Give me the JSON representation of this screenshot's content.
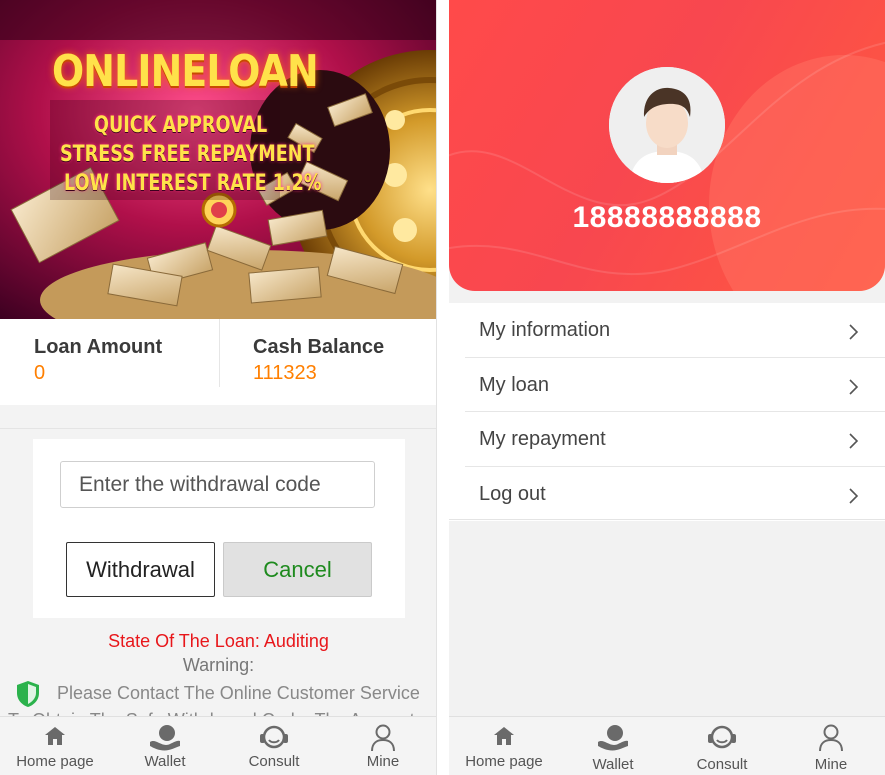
{
  "left": {
    "banner": {
      "title": "ONLINELOAN",
      "lines": [
        "QUICK APPROVAL",
        "STRESS FREE REPAYMENT",
        "LOW INTEREST RATE 1.2%"
      ]
    },
    "stats": {
      "loan_amount_label": "Loan Amount",
      "loan_amount_value": "0",
      "cash_balance_label": "Cash Balance",
      "cash_balance_value": "111323"
    },
    "withdraw": {
      "code_placeholder": "Enter the withdrawal code",
      "withdraw_label": "Withdrawal",
      "cancel_label": "Cancel"
    },
    "status": {
      "state_text": "State Of The Loan:   Auditing",
      "warning_text": "Warning:",
      "notice_text": "Please Contact The Online Customer Service To Obtain The Safe Withdrawal Code. The Account Funds"
    }
  },
  "right": {
    "phone": "18888888888",
    "menu": [
      {
        "label": "My information"
      },
      {
        "label": "My loan"
      },
      {
        "label": "My repayment"
      },
      {
        "label": "Log out"
      }
    ]
  },
  "nav": {
    "left_items": [
      {
        "label": "Home page",
        "icon": "home-icon"
      },
      {
        "label": "Wallet",
        "icon": "wallet-icon"
      },
      {
        "label": "Consult",
        "icon": "consult-icon"
      },
      {
        "label": "Mine",
        "icon": "user-icon"
      }
    ],
    "right_items": [
      {
        "label": "Home page",
        "icon": "home-icon"
      },
      {
        "label": "Wallet",
        "icon": "wallet-icon"
      },
      {
        "label": "Consult",
        "icon": "consult-icon"
      },
      {
        "label": "Mine",
        "icon": "user-icon"
      }
    ]
  },
  "colors": {
    "accent_orange": "#ff7f00",
    "status_red": "#e8161a",
    "cancel_green": "#1e8a1e",
    "hero_red": "#f8474f",
    "shield_green": "#2bb24c"
  }
}
